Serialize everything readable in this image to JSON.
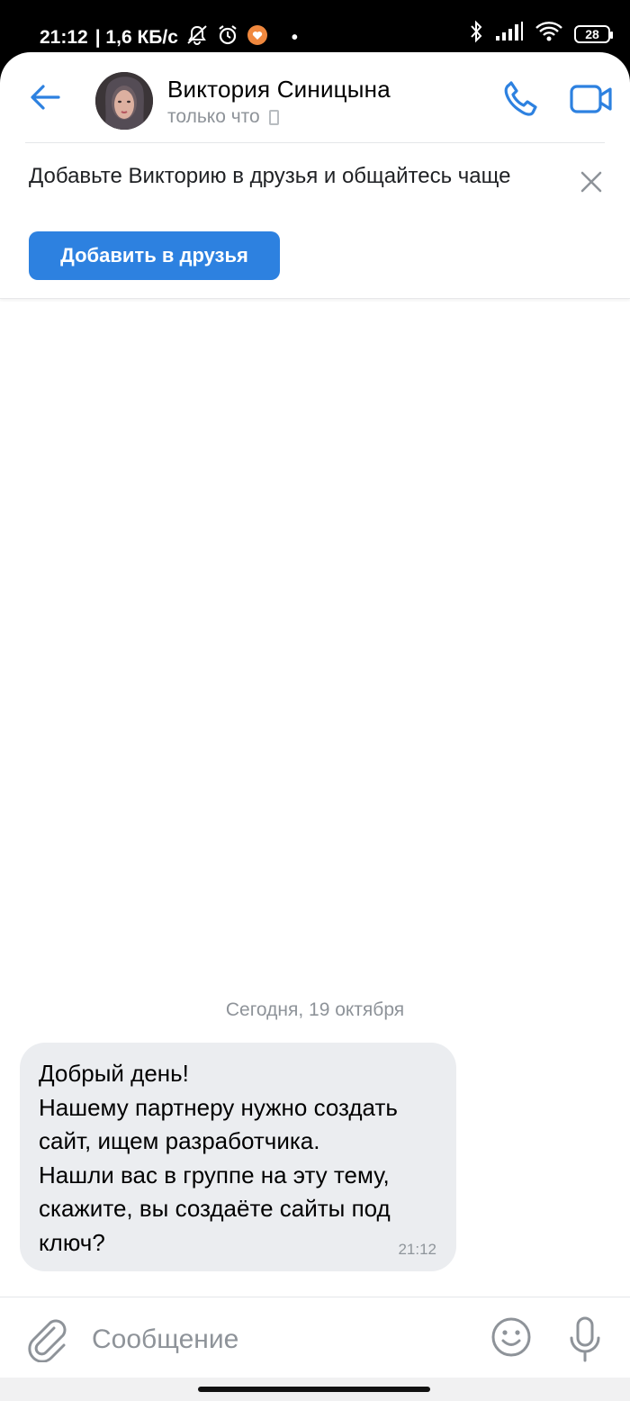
{
  "status_bar": {
    "time": "21:12",
    "network_speed": "| 1,6 КБ/с",
    "battery": "28",
    "icons": [
      "silent-notifications-icon",
      "alarm-icon",
      "app-notification-icon",
      "bluetooth-icon",
      "signal-icon",
      "wifi-icon",
      "battery-icon"
    ]
  },
  "header": {
    "contact_name": "Виктория Синицына",
    "last_seen": "только что",
    "accent": "#2d81e0"
  },
  "banner": {
    "text": "Добавьте Викторию в друзья и общайтесь чаще",
    "button_label": "Добавить в друзья"
  },
  "chat": {
    "date_separator": "Сегодня, 19 октября",
    "messages": [
      {
        "lines": [
          "Добрый день!",
          "Нашему партнеру нужно создать",
          "сайт, ищем разработчика.",
          "Нашли вас в группе на эту тему,",
          "скажите, вы создаёте сайты под",
          "ключ?"
        ],
        "time": "21:12"
      }
    ]
  },
  "composer": {
    "placeholder": "Сообщение"
  }
}
